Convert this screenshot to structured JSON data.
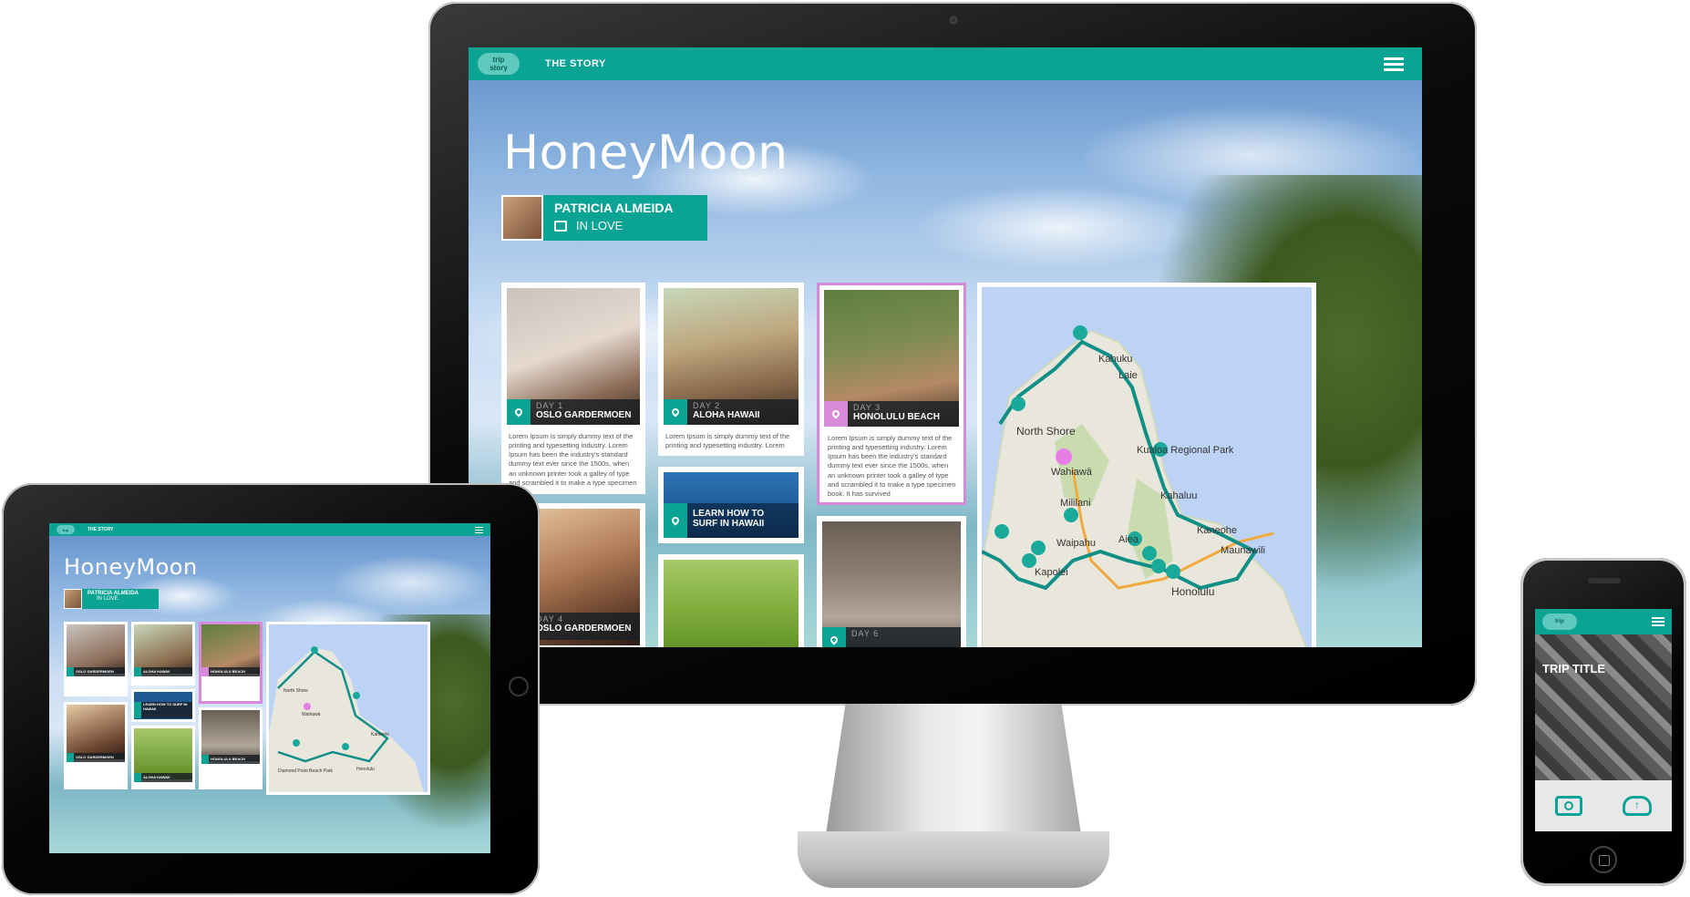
{
  "app": {
    "logo_top": "trip",
    "logo_bottom": "story",
    "nav_title": "THE STORY"
  },
  "story": {
    "title": "HoneyMoon",
    "author_name": "PATRICIA ALMEIDA",
    "author_status": "IN LOVE"
  },
  "cards": [
    {
      "day": "DAY 1",
      "place": "OSLO GARDERMOEN",
      "text": "Lorem Ipsum is simply dummy text of the printing and typesetting industry. Lorem Ipsum has been the industry's standard dummy text ever since the 1500s, when an unknown printer took a galley of type and scrambled it to make a type specimen"
    },
    {
      "day": "DAY 2",
      "place": "ALOHA HAWAII",
      "text": "Lorem Ipsum is simply dummy text of the printing and typesetting industry. Lorem"
    },
    {
      "day": "DAY 3",
      "place": "HONOLULU BEACH",
      "text": "Lorem Ipsum is simply dummy text of the printing and typesetting industry. Lorem Ipsum has been the industry's standard dummy text ever since the 1500s, when an unknown printer took a galley of type and scrambled it to make a type specimen book. It has survived"
    },
    {
      "day": "",
      "place": "LEARN HOW TO SURF IN HAWAII",
      "text": ""
    },
    {
      "day": "DAY 4",
      "place": "OSLO GARDERMOEN",
      "text": ""
    },
    {
      "day": "DAY 6",
      "place": "",
      "text": ""
    }
  ],
  "map": {
    "labels": [
      "Kahuku",
      "Laie",
      "North Shore",
      "Kualoa Regional Park",
      "Wahiawā",
      "Mililani",
      "Kahaluu",
      "Kaneohe",
      "Maunawili",
      "Waipahu",
      "Kapolei",
      "Honolulu",
      "Aiea"
    ]
  },
  "tablet": {
    "cards": [
      {
        "place": "OSLO GARDERMOEN"
      },
      {
        "place": "ALOHA HAWAII"
      },
      {
        "place": "HONOLULU BEACH"
      },
      {
        "place": "LEARN HOW TO SURF IN HAWAII"
      },
      {
        "place": "OSLO GARDERMOEN"
      },
      {
        "place": "ALOHA HAWAII"
      },
      {
        "place": "HONOLULU BEACH"
      }
    ],
    "map_labels": [
      "North Shore",
      "Wahiawā",
      "Kaneohe",
      "Honolulu",
      "Diamond Point Beach Park"
    ]
  },
  "phone": {
    "trip_title": "TRIP TITLE",
    "camera_icon": "camera-icon",
    "upload_icon": "cloud-upload-icon"
  },
  "colors": {
    "accent": "#0aa394",
    "highlight": "#d78ad9"
  }
}
